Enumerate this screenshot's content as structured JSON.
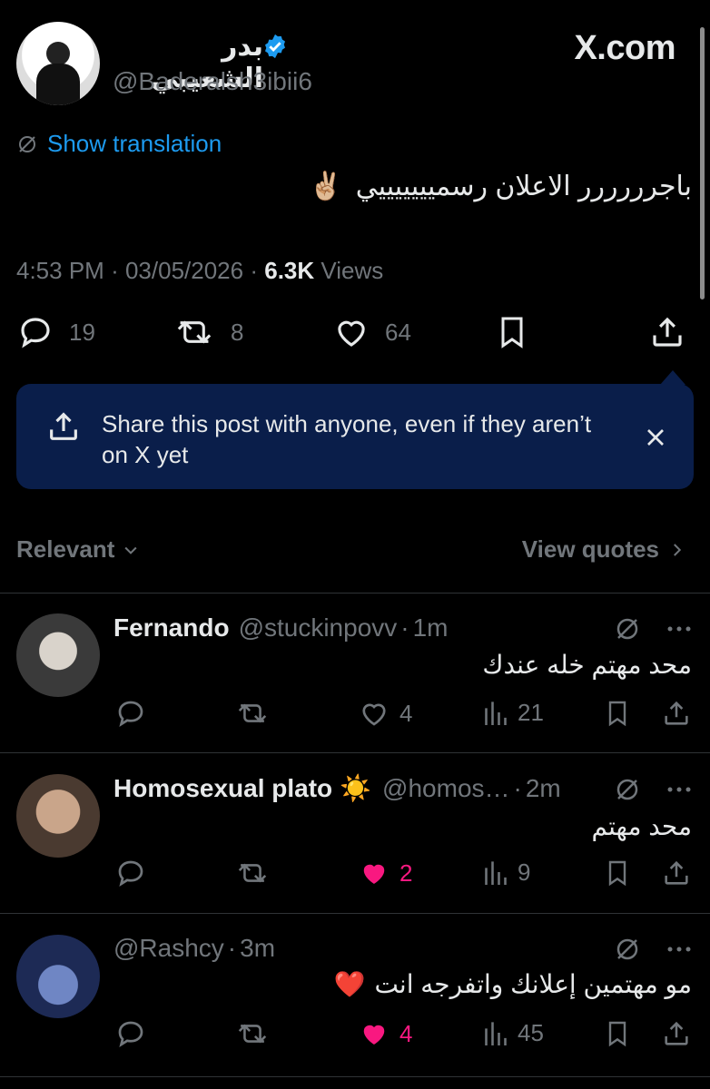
{
  "author": {
    "name": "بدر الشعيبي",
    "handle": "@Baderalsh3ibii6",
    "verified": true
  },
  "site": "X.com",
  "translate_label": "Show translation",
  "tweet": {
    "text": "باجرررررر الاعلان رسميييييييي",
    "emoji": "✌🏼",
    "time": "4:53 PM",
    "sep": "·",
    "date": "03/05/2026",
    "views_count": "6.3K",
    "views_label": "Views"
  },
  "actions": {
    "replies": "19",
    "reposts": "8",
    "likes": "64"
  },
  "tooltip": {
    "text": "Share this post with anyone, even if they aren’t on X yet"
  },
  "sort": {
    "label": "Relevant",
    "view_quotes": "View quotes"
  },
  "replies": [
    {
      "name": "Fernando",
      "handle": "@stuckinpovv",
      "time": "1m",
      "text": "محد مهتم خله عندك",
      "emoji": "",
      "replies": "",
      "reposts": "",
      "likes": "4",
      "liked": false,
      "views": "21"
    },
    {
      "name": "Homosexual plato",
      "name_emoji": "☀️",
      "handle": "@homos…",
      "time": "2m",
      "text": "محد مهتم",
      "emoji": "",
      "replies": "",
      "reposts": "",
      "likes": "2",
      "liked": true,
      "views": "9"
    },
    {
      "name": "",
      "handle": "@Rashcy",
      "time": "3m",
      "text": "مو مهتمين إعلانك واتفرجه انت",
      "emoji": "❤️",
      "replies": "",
      "reposts": "",
      "likes": "4",
      "liked": true,
      "views": "45"
    }
  ],
  "colors": {
    "background": "#000000",
    "accent": "#1d9bf0",
    "like": "#f91880",
    "muted": "#71767b",
    "tooltip": "#0a1e4a"
  }
}
